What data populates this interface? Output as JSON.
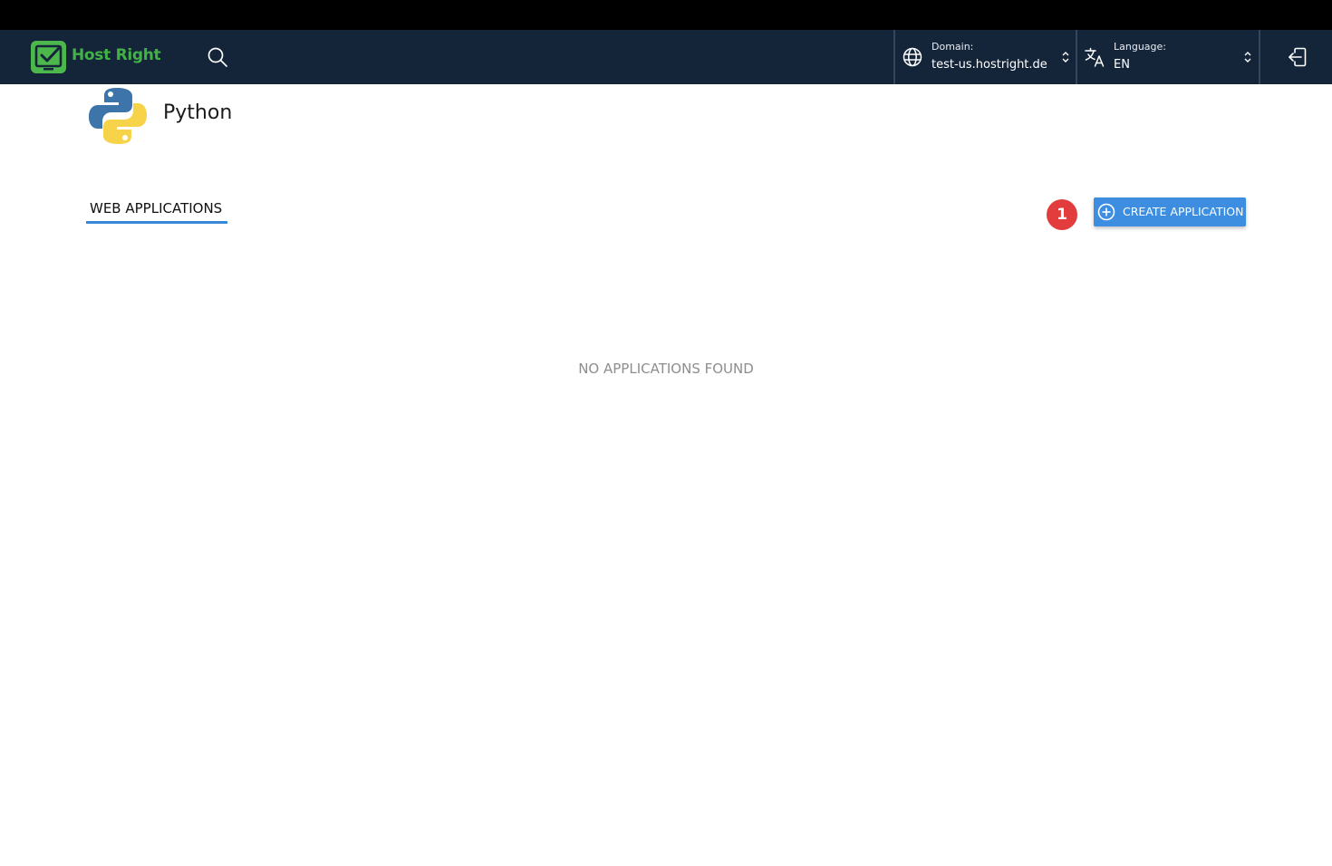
{
  "header": {
    "brand": "Host Right",
    "domain": {
      "label": "Domain:",
      "value": "test-us.hostright.de"
    },
    "language": {
      "label": "Language:",
      "value": "EN"
    }
  },
  "page": {
    "title": "Python"
  },
  "tabs": [
    {
      "label": "WEB APPLICATIONS",
      "active": true
    }
  ],
  "actions": {
    "badge": "1",
    "create_label": "CREATE APPLICATION"
  },
  "empty_state": {
    "message": "NO APPLICATIONS FOUND"
  },
  "icons": {
    "logo": "check-monitor-icon",
    "search": "search-icon",
    "domain": "globe-icon",
    "language": "translate-icon",
    "dropdown": "chevron-up-down-icon",
    "logout": "logout-icon",
    "create": "plus-circle-icon",
    "page": "python-logo"
  },
  "colors": {
    "navbar": "#14253a",
    "brand": "#42b246",
    "accent": "#3d8ee0",
    "badge": "#e23c3c",
    "tab_underline": "#3a87d8"
  }
}
